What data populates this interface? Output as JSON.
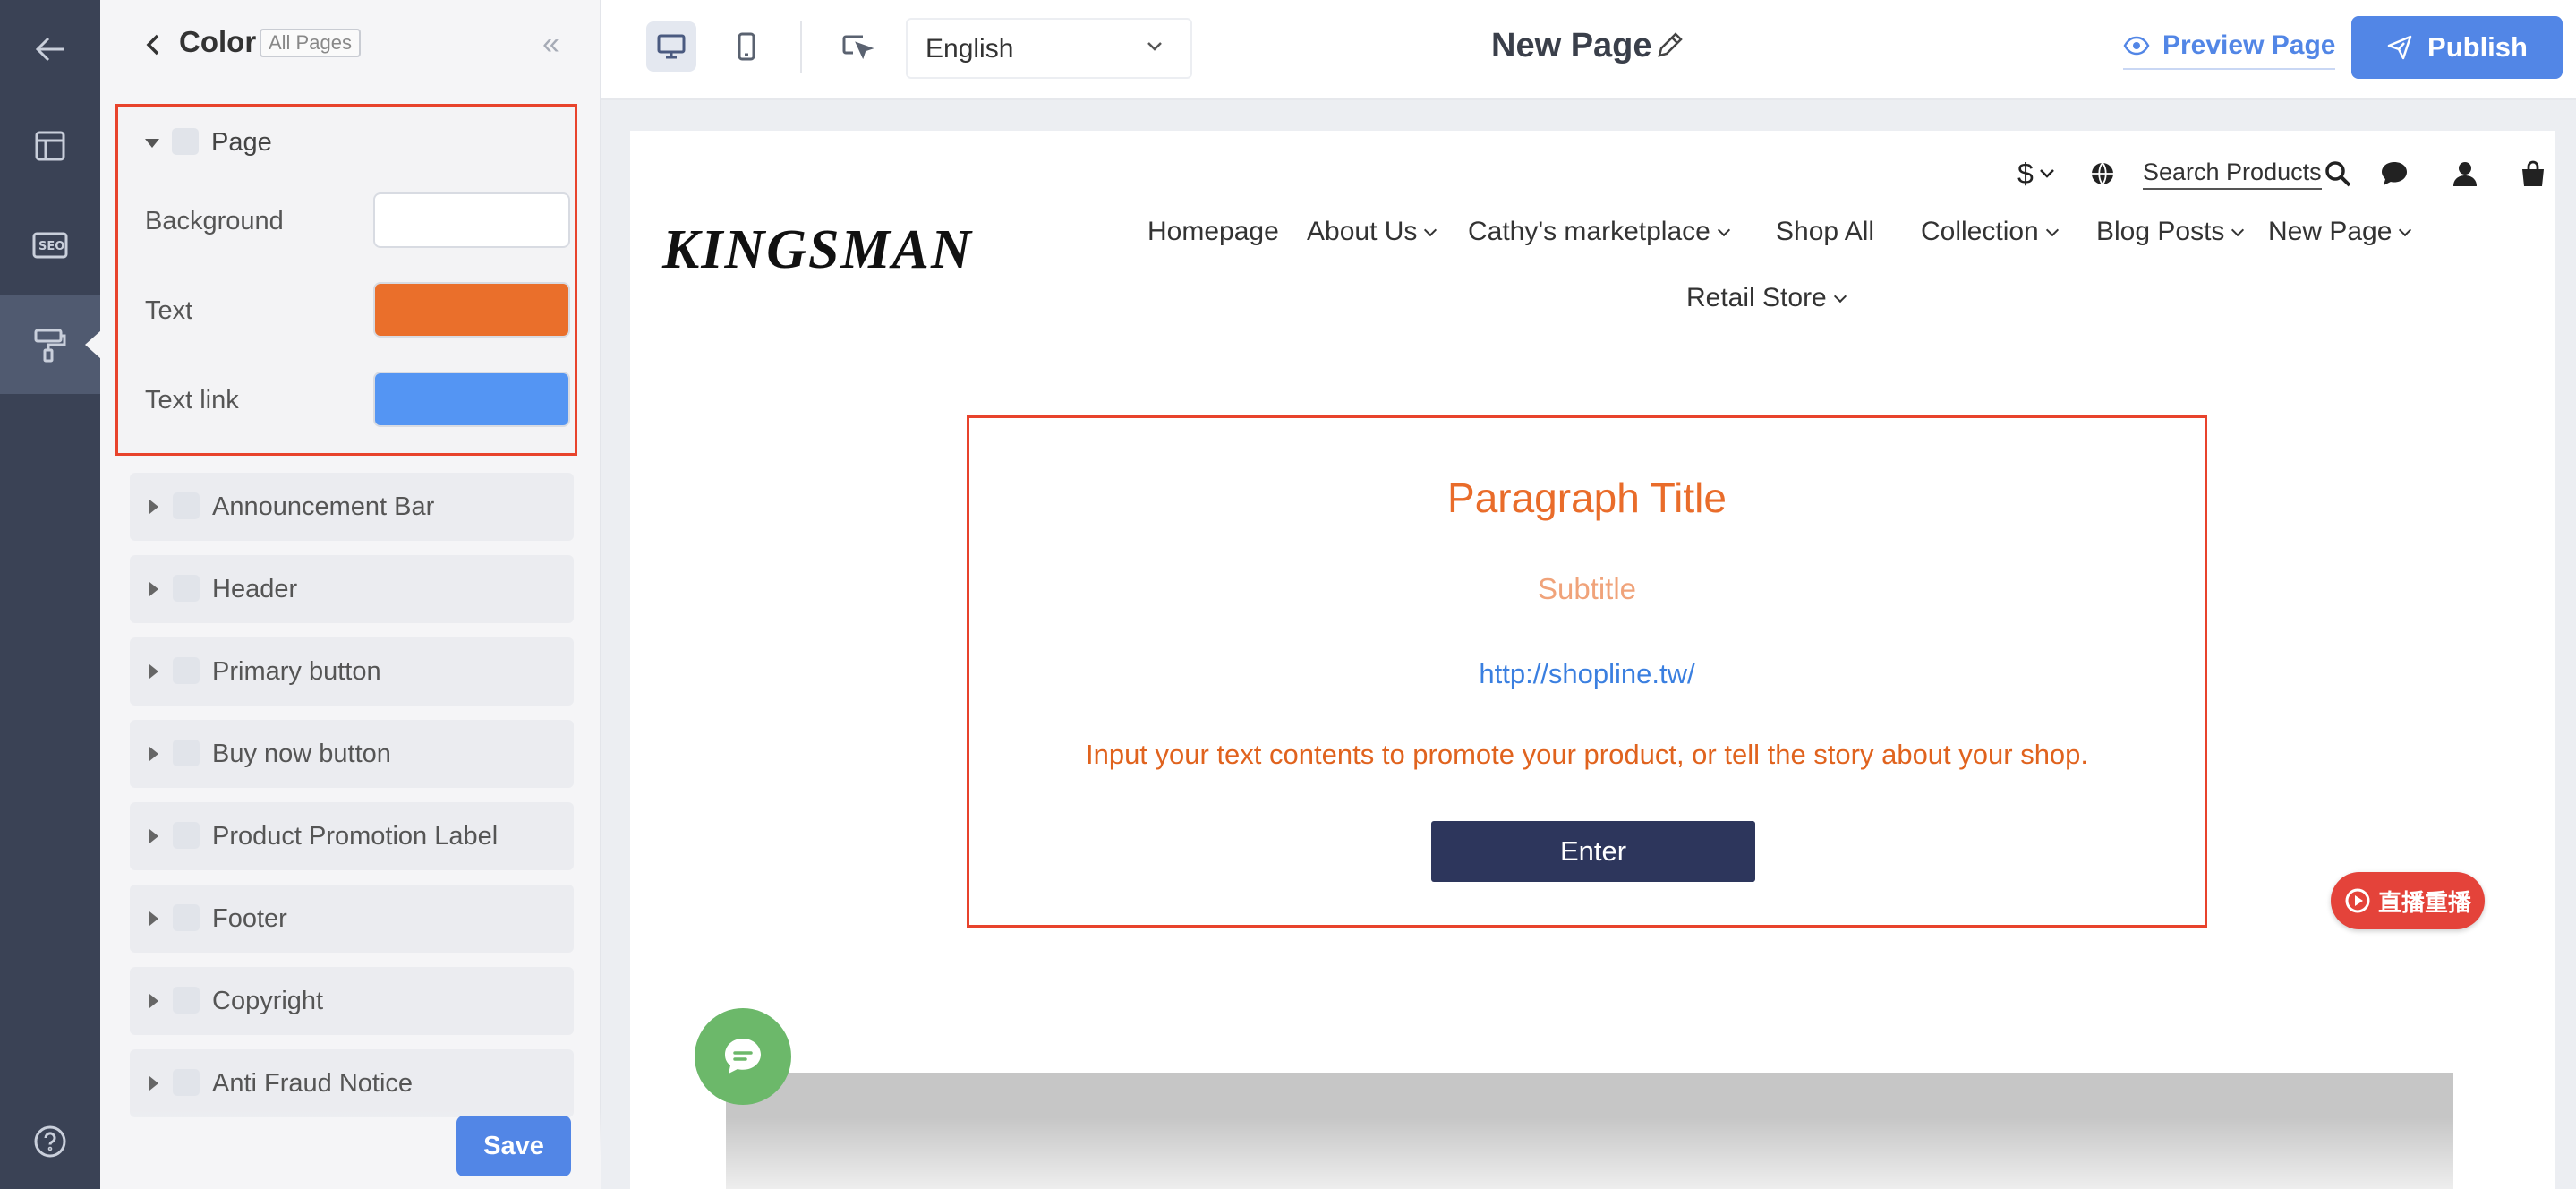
{
  "panel": {
    "title": "Color",
    "scope_tag": "All Pages",
    "page_section": {
      "label": "Page",
      "fields": [
        {
          "label": "Background",
          "color": "#ffffff"
        },
        {
          "label": "Text",
          "color": "#ea6f2b"
        },
        {
          "label": "Text link",
          "color": "#5495f3"
        }
      ]
    },
    "sections": [
      {
        "label": "Announcement Bar"
      },
      {
        "label": "Header"
      },
      {
        "label": "Primary button"
      },
      {
        "label": "Buy now button"
      },
      {
        "label": "Product Promotion Label"
      },
      {
        "label": "Footer"
      },
      {
        "label": "Copyright"
      },
      {
        "label": "Anti Fraud Notice"
      }
    ],
    "save_label": "Save"
  },
  "toolbar": {
    "language": "English",
    "page_name": "New Page",
    "preview_label": "Preview Page",
    "publish_label": "Publish"
  },
  "site": {
    "currency": "$",
    "search_label": "Search Products",
    "logo": "KINGSMAN",
    "nav": [
      {
        "label": "Homepage",
        "dropdown": false
      },
      {
        "label": "About Us",
        "dropdown": true
      },
      {
        "label": "Cathy's marketplace",
        "dropdown": true
      },
      {
        "label": "Shop All",
        "dropdown": false
      },
      {
        "label": "Collection",
        "dropdown": true
      },
      {
        "label": "Blog Posts",
        "dropdown": true
      },
      {
        "label": "New Page",
        "dropdown": true
      },
      {
        "label": "Retail Store",
        "dropdown": true
      }
    ],
    "content": {
      "title": "Paragraph Title",
      "subtitle": "Subtitle",
      "link": "http://shopline.tw/",
      "body": "Input your text contents to promote your product, or tell the story about your shop.",
      "button": "Enter"
    },
    "live_badge": "直播重播"
  },
  "colors": {
    "rail": "#3a4255",
    "accent": "#5286e6",
    "highlight_border": "#e8432c",
    "text_orange": "#e96c2a",
    "button_navy": "#2d365c",
    "chat_green": "#6cb86a"
  }
}
